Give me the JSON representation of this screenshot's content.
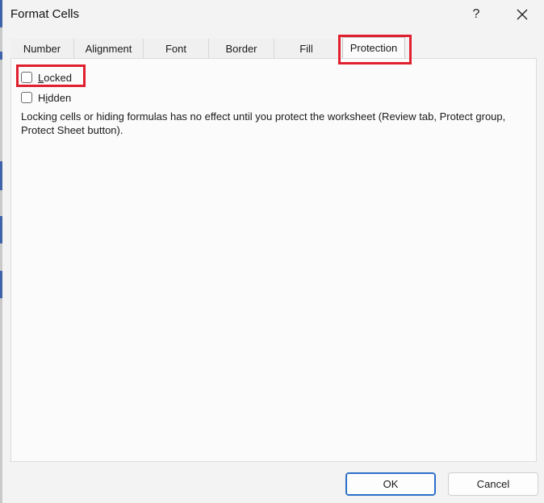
{
  "window": {
    "title": "Format Cells",
    "help_label": "?",
    "close_icon": "close-icon"
  },
  "tabs": [
    {
      "label": "Number"
    },
    {
      "label": "Alignment"
    },
    {
      "label": "Font"
    },
    {
      "label": "Border"
    },
    {
      "label": "Fill"
    },
    {
      "label": "Protection",
      "active": true
    }
  ],
  "protection": {
    "locked": {
      "prefix": "",
      "accel": "L",
      "rest": "ocked",
      "checked": false
    },
    "hidden": {
      "prefix": "H",
      "accel": "i",
      "rest": "dden",
      "checked": false
    },
    "info_text": "Locking cells or hiding formulas has no effect until you protect the worksheet (Review tab, Protect group, Protect Sheet button)."
  },
  "buttons": {
    "ok_label": "OK",
    "cancel_label": "Cancel"
  },
  "colors": {
    "highlight": "#e0202e",
    "ok_border": "#2a6fc9"
  }
}
